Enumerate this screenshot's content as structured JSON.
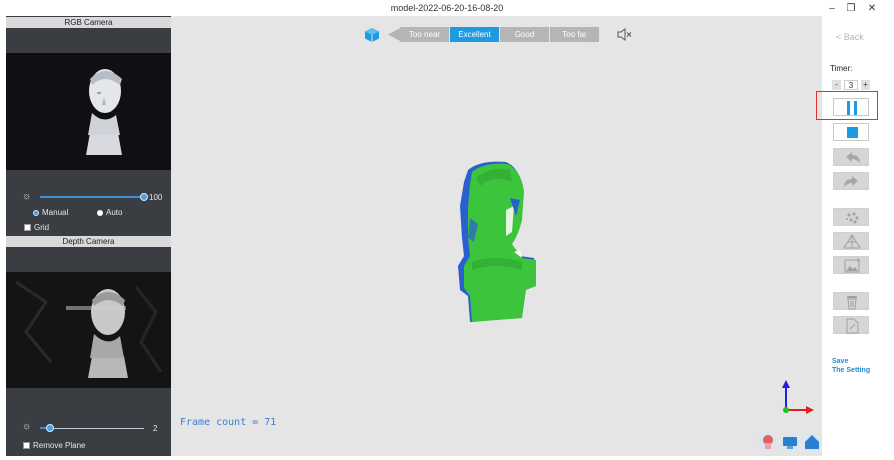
{
  "window": {
    "title": "model-2022-06-20-16-08-20",
    "minimize": "–",
    "maximize": "❐",
    "close": "✕"
  },
  "rgb_panel": {
    "header": "RGB Camera",
    "exposure_value": "100",
    "exposure_level": 1.0,
    "mode_manual": "Manual",
    "mode_auto": "Auto",
    "selected_mode": "Manual",
    "grid_label": "Grid"
  },
  "depth_panel": {
    "header": "Depth Camera",
    "exposure_value": "2",
    "exposure_level": 0.1,
    "remove_plane_label": "Remove Plane"
  },
  "quality": {
    "segments": [
      "Too near",
      "Excellent",
      "Good",
      "Too far"
    ],
    "active": "Excellent"
  },
  "viewport": {
    "frame_count": "Frame count = 71"
  },
  "right": {
    "back": "< Back",
    "timer_label": "Timer:",
    "timer_minus": "-",
    "timer_value": "3",
    "timer_plus": "+",
    "save_line1": "Save",
    "save_line2": "The Setting"
  },
  "colors": {
    "accent": "#1e9be0",
    "model_green": "#3cc43c",
    "model_blue": "#2a5fd0",
    "highlight_red": "#e03030"
  }
}
